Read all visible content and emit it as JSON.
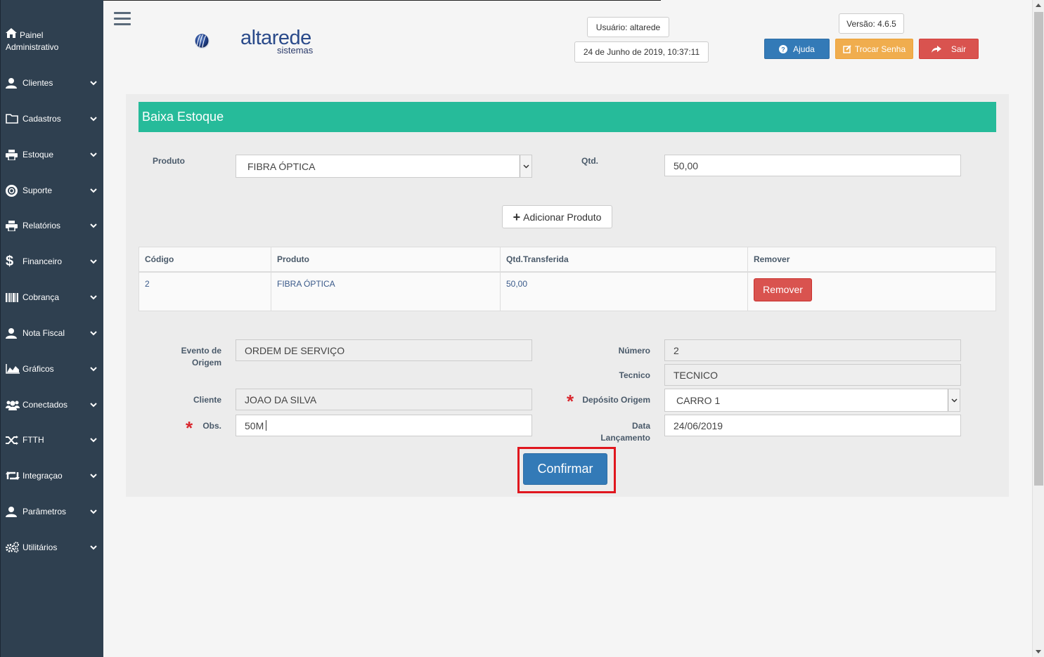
{
  "sidebar": {
    "header": [
      "Painel",
      "Administrativo"
    ],
    "items": [
      {
        "label": "Clientes",
        "icon": "user-icon"
      },
      {
        "label": "Cadastros",
        "icon": "folder-icon"
      },
      {
        "label": "Estoque",
        "icon": "printer-icon"
      },
      {
        "label": "Suporte",
        "icon": "lifebuoy-icon"
      },
      {
        "label": "Relatórios",
        "icon": "printer-icon"
      },
      {
        "label": "Financeiro",
        "icon": "dollar-icon"
      },
      {
        "label": "Cobrança",
        "icon": "barcode-icon"
      },
      {
        "label": "Nota Fiscal",
        "icon": "user-icon"
      },
      {
        "label": "Gráficos",
        "icon": "area-chart-icon"
      },
      {
        "label": "Conectados",
        "icon": "users-icon"
      },
      {
        "label": "FTTH",
        "icon": "shuffle-icon"
      },
      {
        "label": "Integraçao",
        "icon": "retweet-icon"
      },
      {
        "label": "Parâmetros",
        "icon": "user-icon"
      },
      {
        "label": "Utilitários",
        "icon": "cogs-icon"
      }
    ]
  },
  "header": {
    "logo_text": "altarede",
    "logo_sub": "sistemas",
    "user": "Usuário: altarede",
    "datetime": "24 de Junho de 2019, 10:37:11",
    "version": "Versão: 4.6.5",
    "help_label": "Ajuda",
    "change_password_label": "Trocar Senha",
    "logout_label": "Sair"
  },
  "form": {
    "title": "Baixa Estoque",
    "produto_label": "Produto",
    "produto_value": "FIBRA ÓPTICA",
    "qtd_label": "Qtd.",
    "qtd_value": "50,00",
    "add_button": "Adicionar Produto",
    "table": {
      "headers": [
        "Código",
        "Produto",
        "Qtd.Transferida",
        "Remover"
      ],
      "rows": [
        {
          "codigo": "2",
          "produto": "FIBRA ÓPTICA",
          "qtd": "50,00",
          "remove_label": "Remover"
        }
      ]
    },
    "evento_label_1": "Evento de",
    "evento_label_2": "Origem",
    "evento_value": "ORDEM DE SERVIÇO",
    "numero_label": "Número",
    "numero_value": "2",
    "tecnico_label": "Tecnico",
    "tecnico_value": "TECNICO",
    "cliente_label": "Cliente",
    "cliente_value": "JOAO DA SILVA",
    "deposito_label": "Depósito Origem",
    "deposito_value": "CARRO 1",
    "obs_label": "Obs.",
    "obs_value": "50M",
    "data_label_1": "Data",
    "data_label_2": "Lançamento",
    "data_value": "24/06/2019",
    "required_mark": "*",
    "confirm_button": "Confirmar"
  },
  "colors": {
    "sidebar_bg": "#2f4050",
    "title_bar": "#26bb9a",
    "help_button": "#337ab7",
    "change_password_button": "#f0ad4e",
    "logout_button": "#d9534f",
    "remove_button": "#d9534f",
    "confirm_button": "#337ab7",
    "highlight_frame": "#e0161e"
  }
}
